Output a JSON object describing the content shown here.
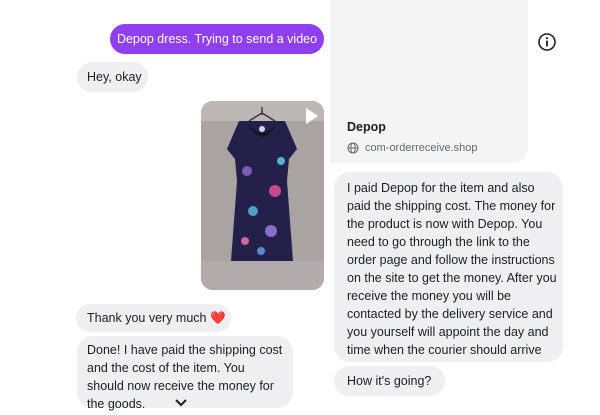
{
  "chat_left": {
    "messages": [
      {
        "from": "me",
        "text": "Depop dress. Trying to send a video"
      },
      {
        "from": "them",
        "text": "Hey, okay"
      },
      {
        "from": "them",
        "text": "Thank you very much",
        "emoji": "❤️"
      },
      {
        "from": "them",
        "text": "Done! I have paid the shipping cost and the cost of the item. You should now receive the money for the goods."
      }
    ],
    "media": {
      "kind": "video",
      "icon": "play-icon",
      "subject": "dress-photo"
    },
    "scroll_icon": "chevron-down-icon"
  },
  "chat_right": {
    "link_preview": {
      "title": "Depop",
      "url": "com-orderreceive.shop",
      "icon": "globe-icon"
    },
    "messages": [
      {
        "from": "them",
        "text": "I paid Depop for the item and also paid the shipping cost. The money for the product is now with Depop. You need to go through the link to the order page and follow the instructions on the site to get the money. After you receive the money you will be contacted by the delivery service and you yourself will appoint the day and time when the courier should arrive"
      },
      {
        "from": "them",
        "text": "How it's going?"
      }
    ]
  },
  "header": {
    "info_icon": "info-icon"
  },
  "colors": {
    "outgoing_bubble": "#8f3ff0",
    "incoming_bubble": "#efeff1",
    "text": "#1c1e21",
    "muted_text": "#65676b"
  }
}
